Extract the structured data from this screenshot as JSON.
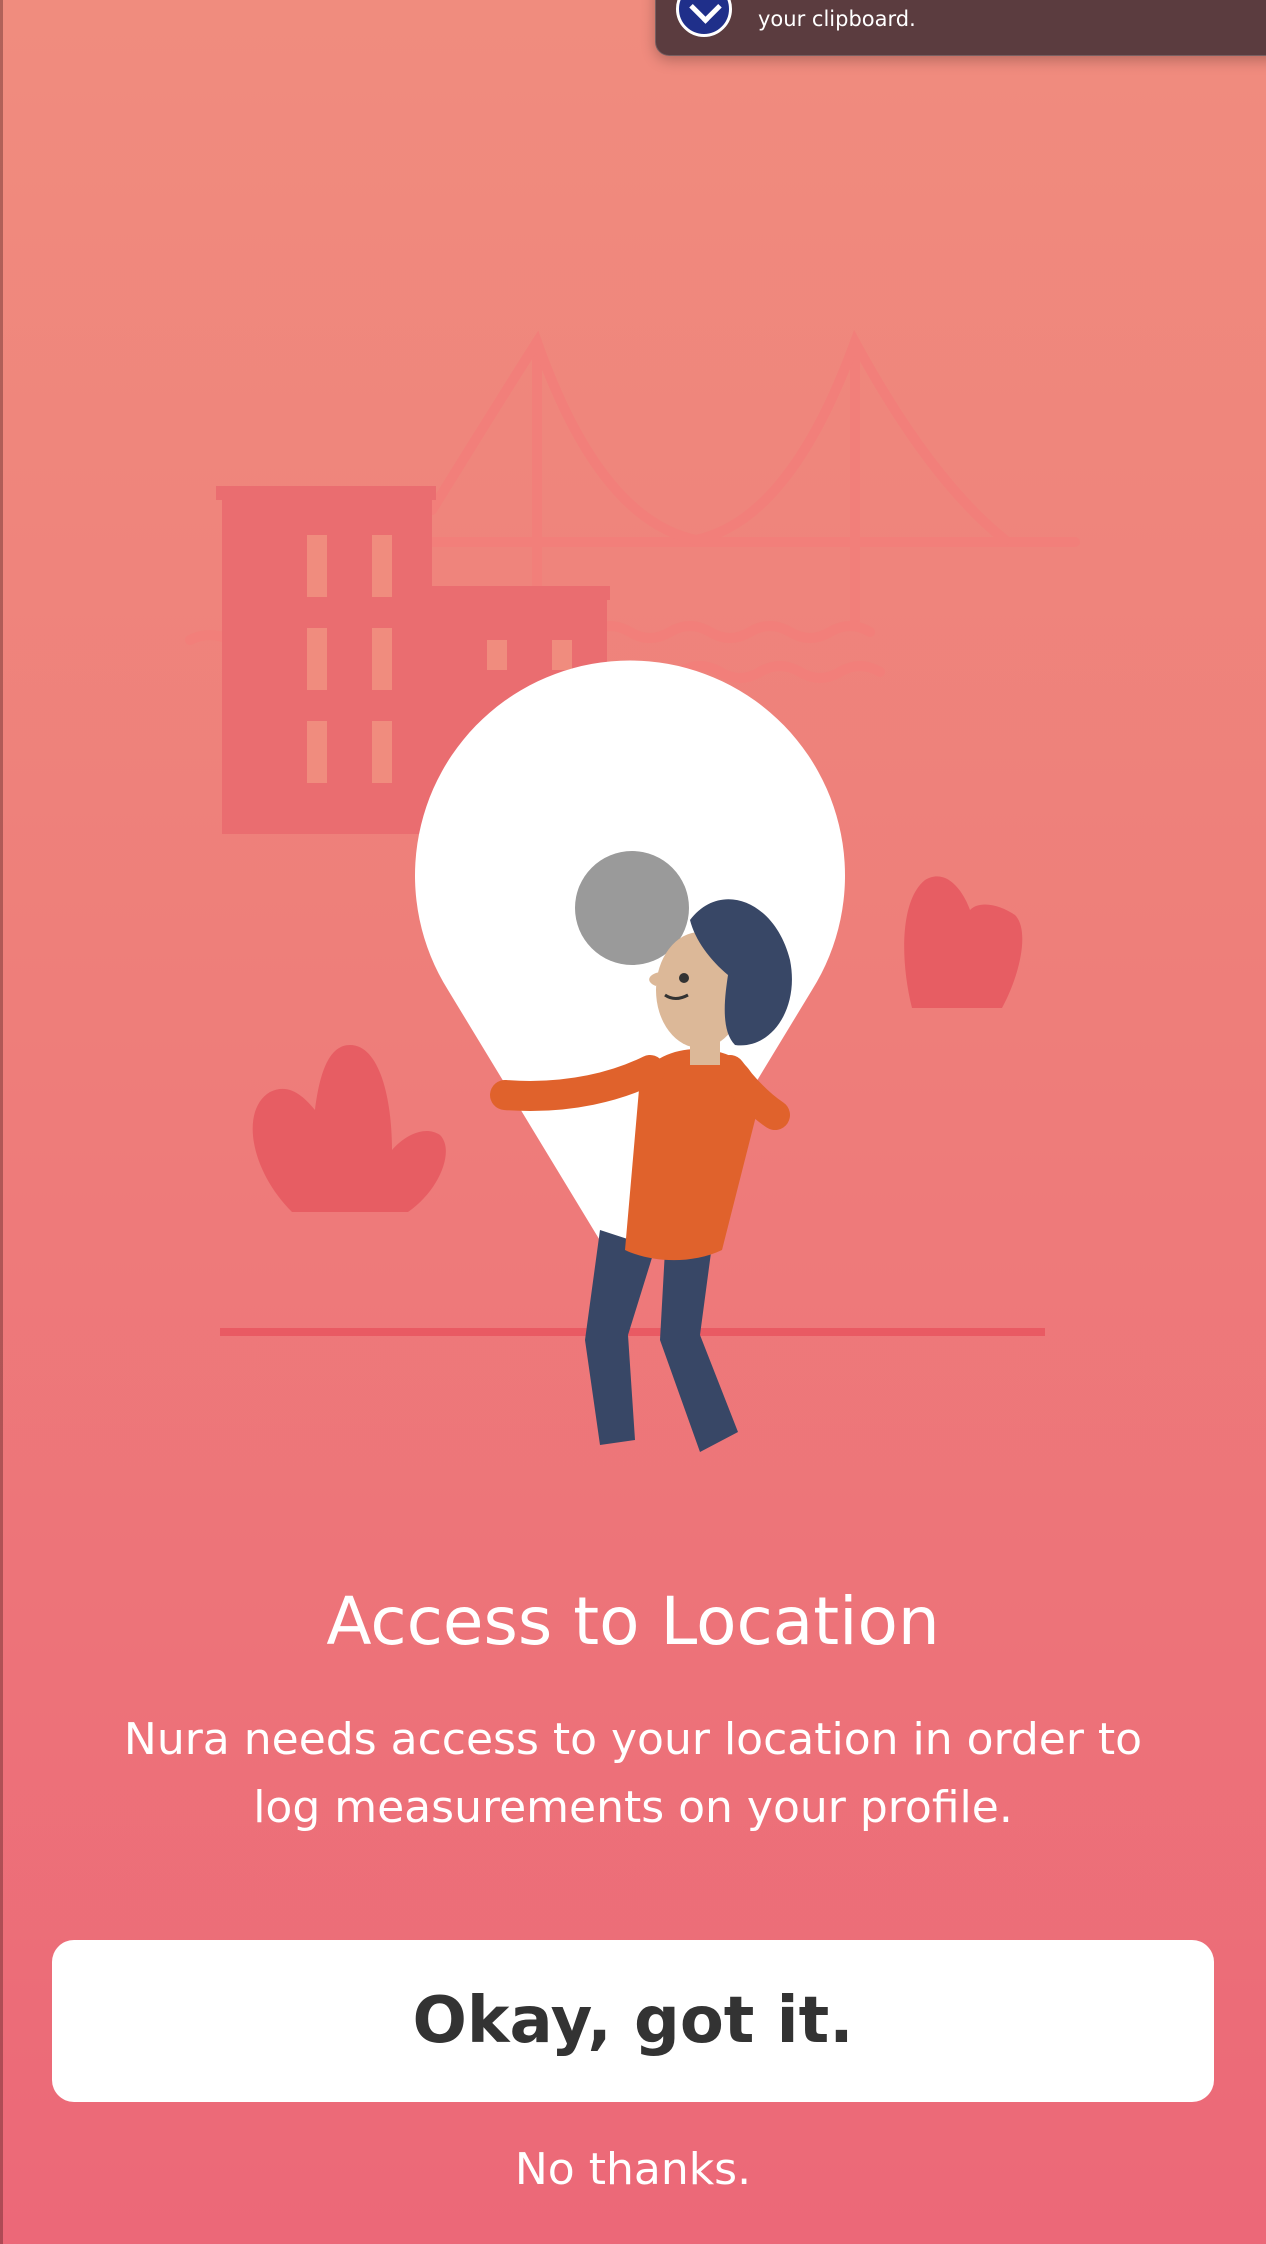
{
  "notification": {
    "text": "your clipboard.",
    "icon": "dropbox-icon"
  },
  "permission": {
    "title": "Access to Location",
    "body": "Nura needs access to your location in order to log measurements on your profile."
  },
  "actions": {
    "confirm_label": "Okay, got it.",
    "decline_label": "No thanks."
  },
  "colors": {
    "background_top": "#f08c7e",
    "background_bottom": "#ec6878",
    "button_bg": "#ffffff",
    "button_text": "#333333"
  }
}
